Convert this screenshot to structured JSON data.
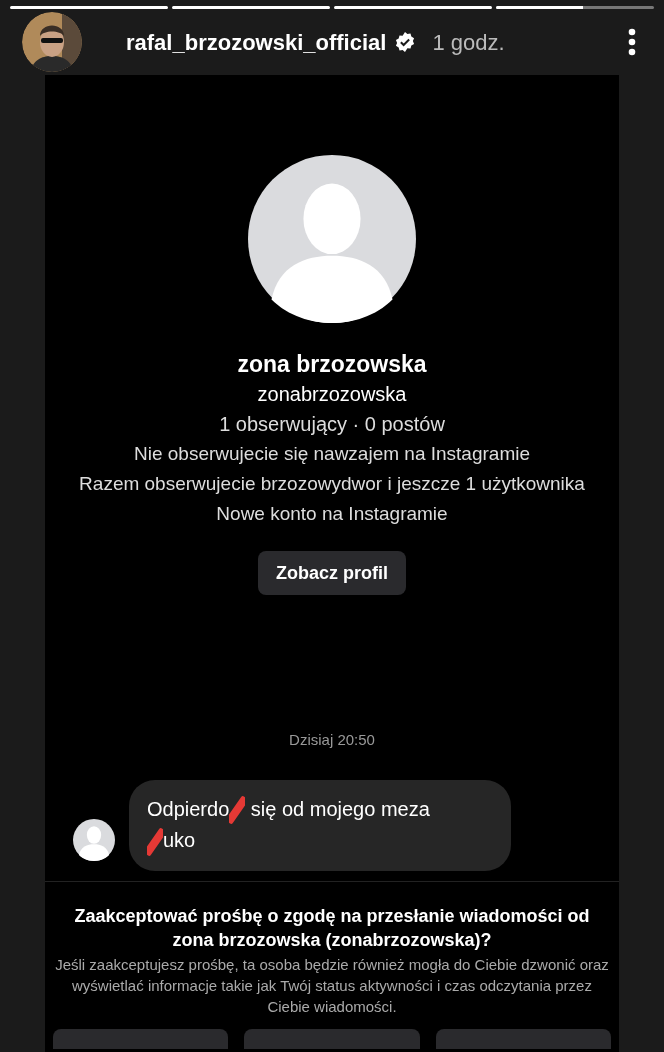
{
  "progress": [
    {
      "level": 1
    },
    {
      "level": 1
    },
    {
      "level": 1
    },
    {
      "level": 0.55
    }
  ],
  "header": {
    "username": "rafal_brzozowski_official",
    "verified": true,
    "time": "1 godz."
  },
  "profile": {
    "name": "zona brzozowska",
    "handle": "zonabrzozowska",
    "stats": "1 obserwujący · 0 postów",
    "info": [
      "Nie obserwujecie się nawzajem na Instagramie",
      "Razem obserwujecie brzozowydwor i jeszcze 1 użytkownika",
      "Nowe konto na Instagramie"
    ],
    "button": "Zobacz profil"
  },
  "timestamp": "Dzisiaj 20:50",
  "message": {
    "segments": [
      {
        "kind": "text",
        "text": "Odpierdo"
      },
      {
        "kind": "censor"
      },
      {
        "kind": "text",
        "text": " się od mojego meza"
      },
      {
        "kind": "break"
      },
      {
        "kind": "censor"
      },
      {
        "kind": "text",
        "text": "uko"
      }
    ]
  },
  "request": {
    "title": "Zaakceptować prośbę o zgodę na przesłanie wiadomości od **zona brzozowska (zonabrzozowska)**?",
    "body": "Jeśli zaakceptujesz prośbę, ta osoba będzie również mogła do Ciebie dzwonić oraz wyświetlać informacje takie jak Twój status aktywności i czas odczytania przez Ciebie wiadomości."
  }
}
